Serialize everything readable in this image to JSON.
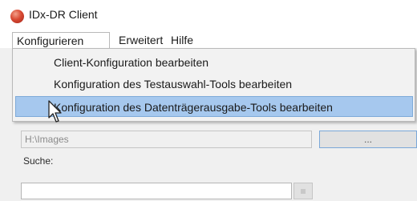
{
  "window": {
    "title": "IDx-DR Client"
  },
  "menubar": {
    "items": [
      "Konfigurieren",
      "Erweitert",
      "Hilfe"
    ]
  },
  "dropdown": {
    "items": [
      "Client-Konfiguration bearbeiten",
      "Konfiguration des Testauswahl-Tools bearbeiten",
      "Konfiguration des Datenträgerausgabe-Tools bearbeiten"
    ],
    "highlight_color": "#a6c8ee"
  },
  "main": {
    "path_value": "H:\\Images",
    "browse_label": "...",
    "search_label": "Suche:"
  }
}
